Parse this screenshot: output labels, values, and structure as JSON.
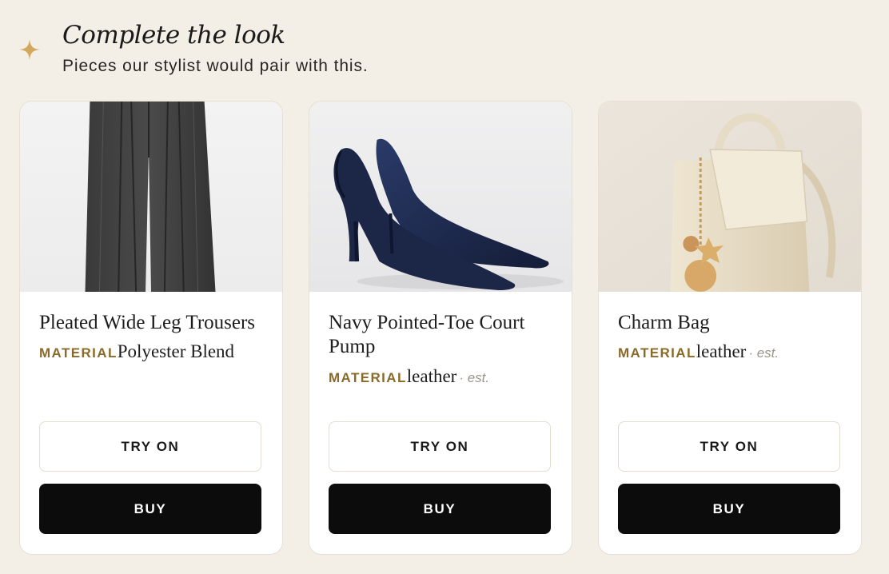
{
  "header": {
    "icon": "sparkle-icon",
    "title": "Complete the look",
    "subtitle": "Pieces our stylist would pair with this."
  },
  "colors": {
    "background": "#f4efe6",
    "accent": "#8a6a2a",
    "sparkle": "#d2a85c",
    "buy_button": "#0c0c0c"
  },
  "products": [
    {
      "name": "Pleated Wide Leg Trousers",
      "material_label": "MATERIAL",
      "material_value": "Polyester Blend",
      "material_note": "",
      "try_label": "TRY ON",
      "buy_label": "BUY",
      "image": "trousers-image"
    },
    {
      "name": "Navy Pointed-Toe Court Pump",
      "material_label": "MATERIAL",
      "material_value": "leather",
      "material_note": "· est.",
      "try_label": "TRY ON",
      "buy_label": "BUY",
      "image": "pumps-image"
    },
    {
      "name": "Charm Bag",
      "material_label": "MATERIAL",
      "material_value": "leather",
      "material_note": "· est.",
      "try_label": "TRY ON",
      "buy_label": "BUY",
      "image": "bag-image"
    }
  ]
}
